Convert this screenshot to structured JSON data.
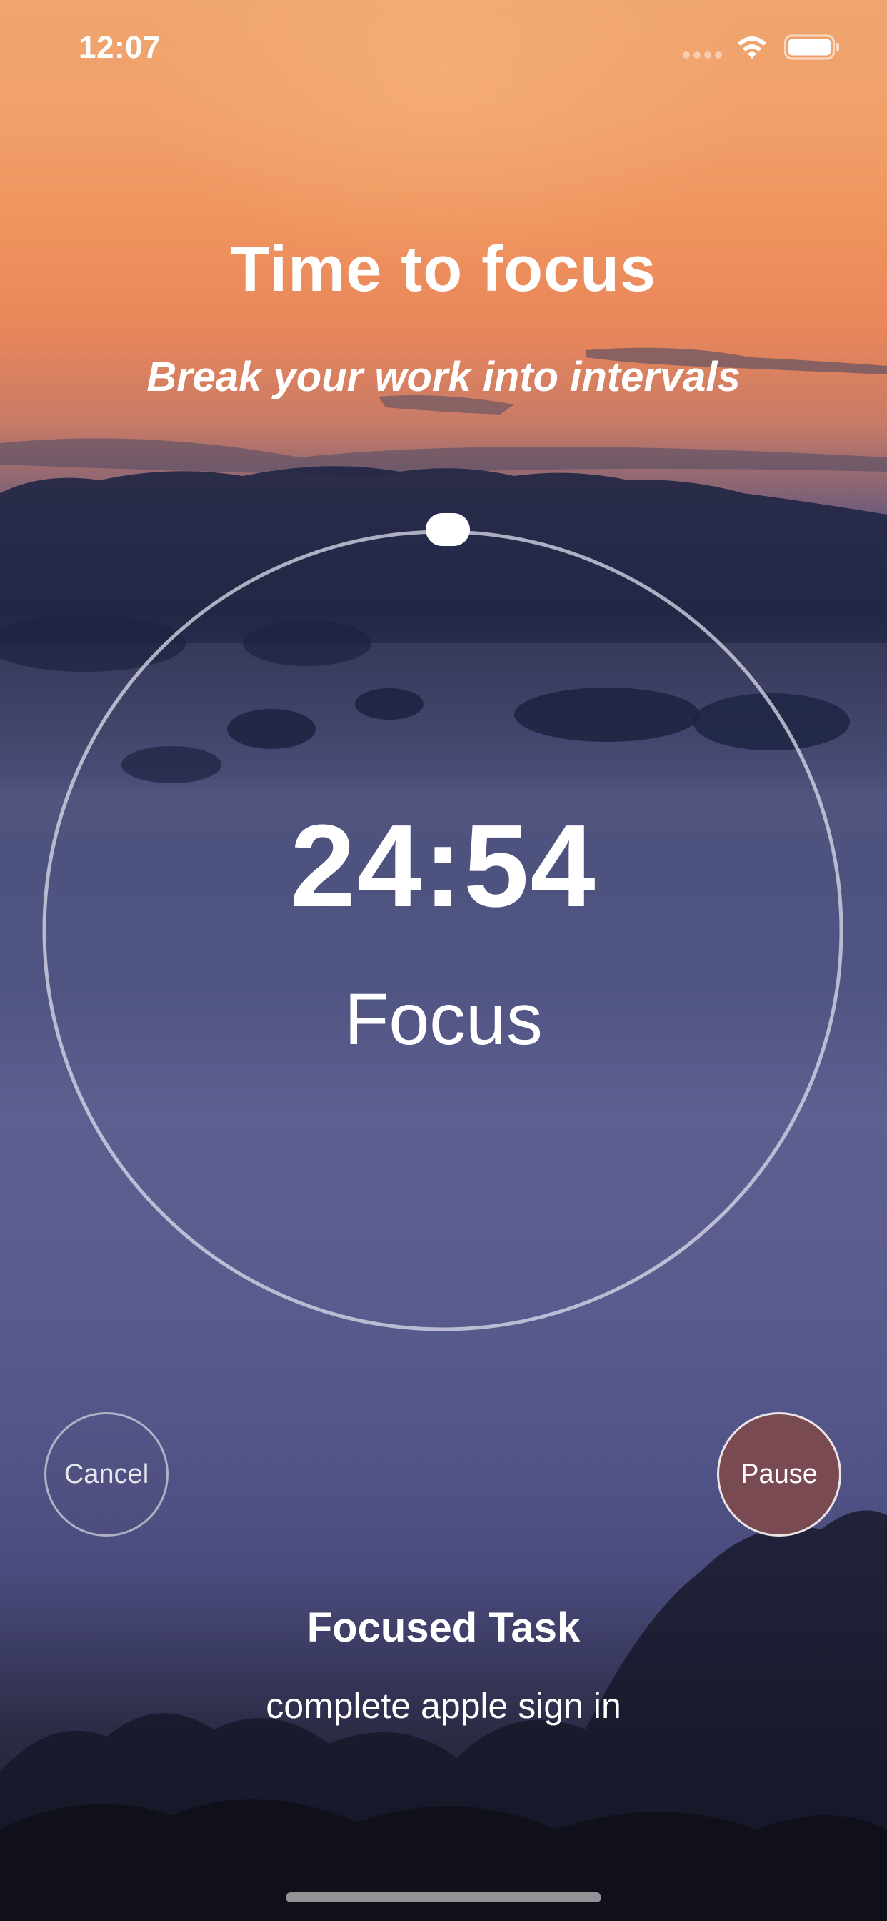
{
  "status_bar": {
    "time": "12:07"
  },
  "header": {
    "title": "Time to focus",
    "subtitle": "Break your work into intervals"
  },
  "timer": {
    "time_remaining": "24:54",
    "mode": "Focus",
    "progress": 0.004
  },
  "controls": {
    "cancel_label": "Cancel",
    "pause_label": "Pause"
  },
  "task": {
    "heading": "Focused Task",
    "name": "complete apple sign in"
  },
  "colors": {
    "pause_button": "#7a4a52",
    "ring": "#c9c9d8"
  },
  "icons": {
    "wifi": "wifi-icon",
    "battery": "battery-icon",
    "cellular": "cellular-signal-icon"
  }
}
